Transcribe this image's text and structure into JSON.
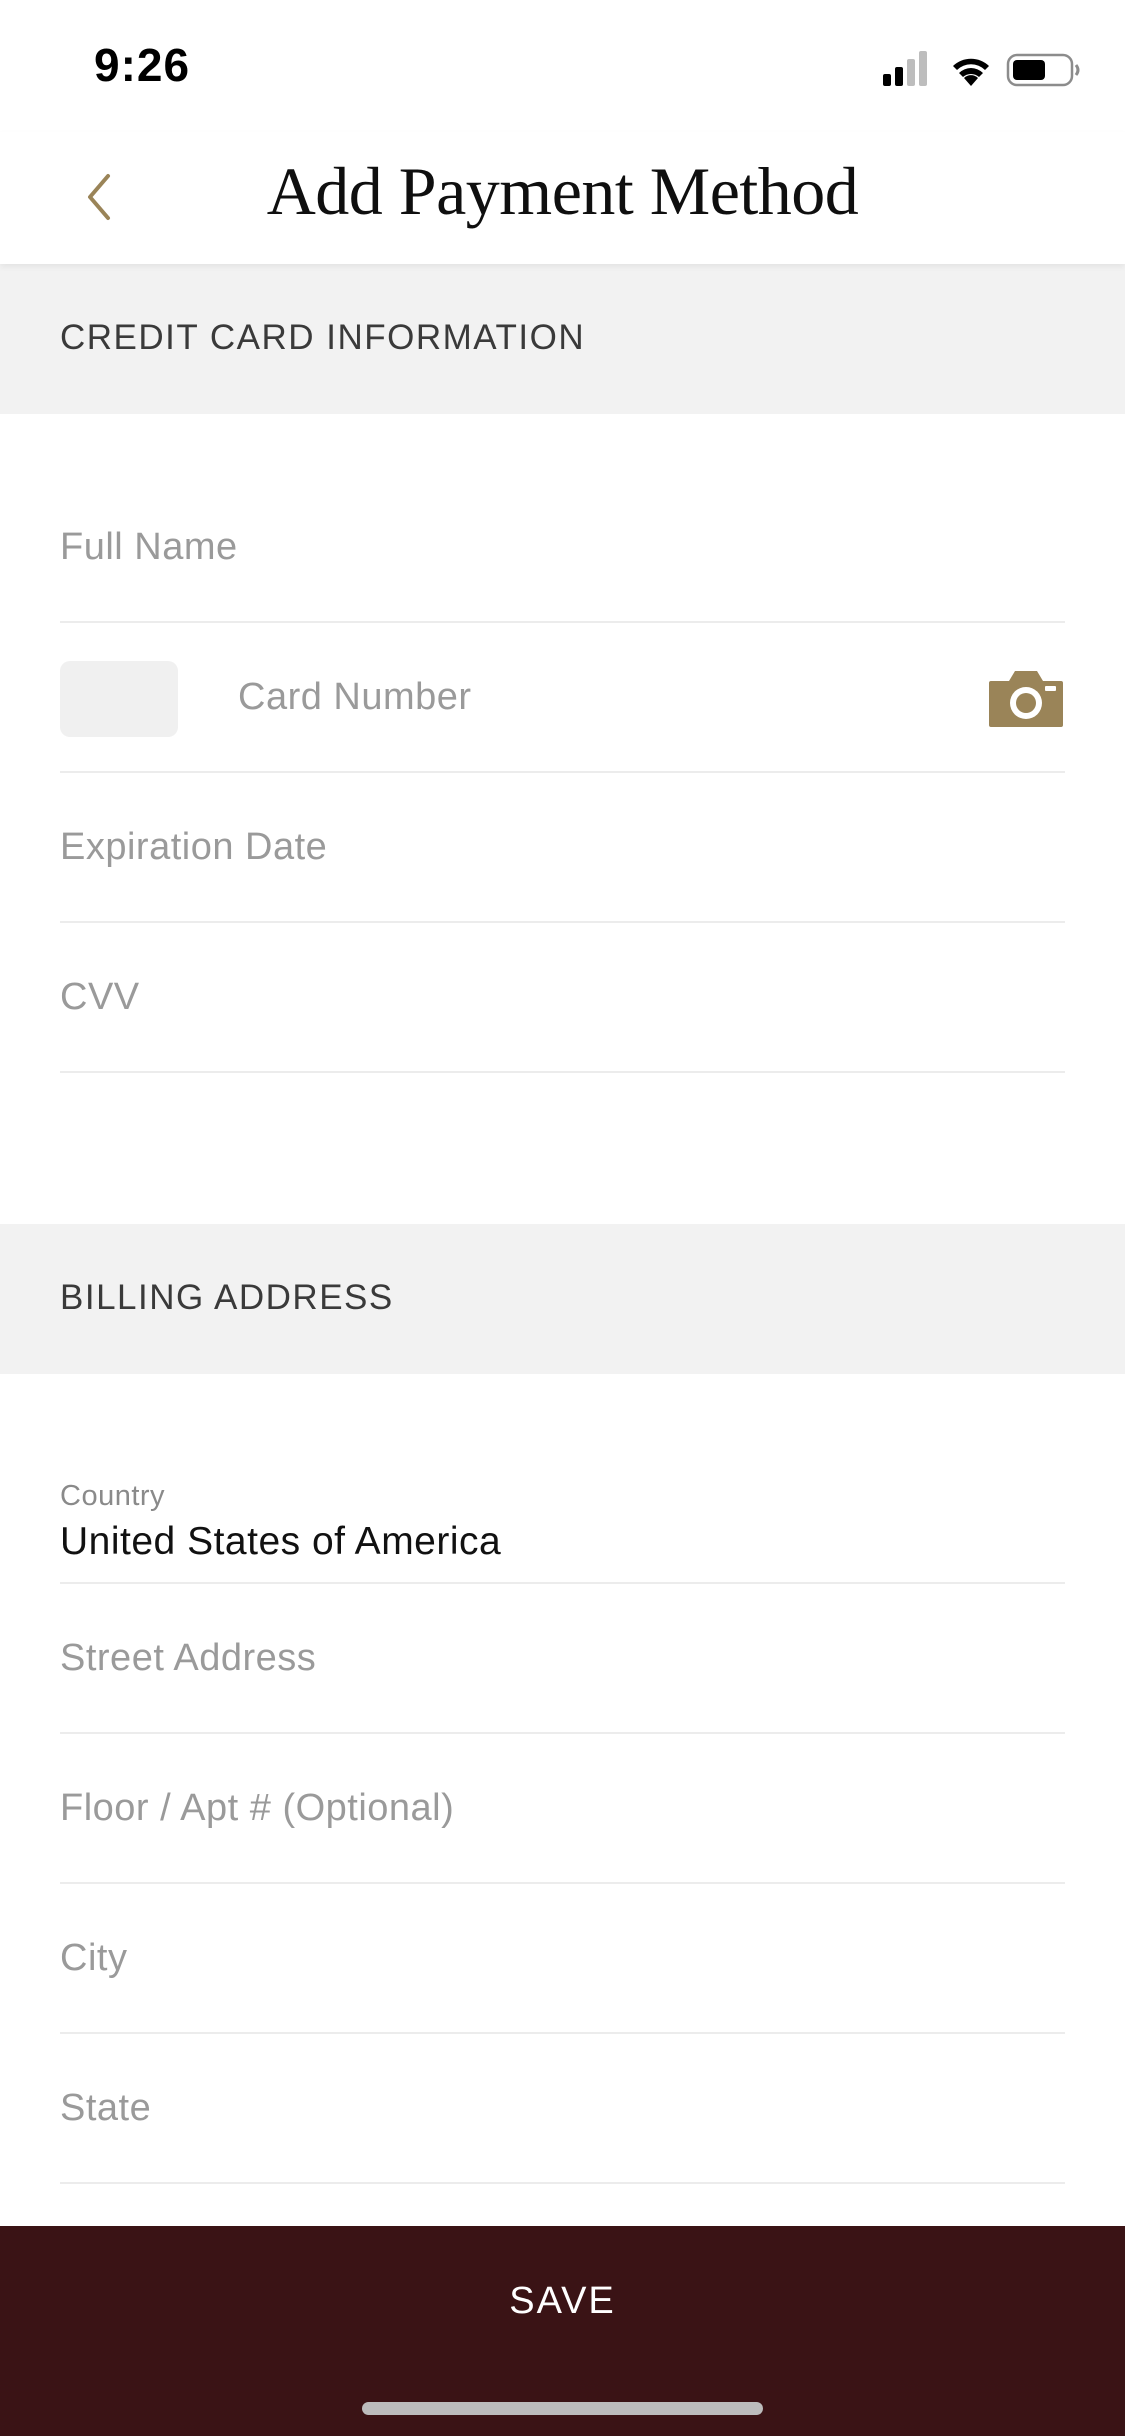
{
  "status_bar": {
    "time": "9:26"
  },
  "nav": {
    "title": "Add Payment Method",
    "back_icon": "chevron-left-icon"
  },
  "credit_card_section": {
    "header": "CREDIT CARD INFORMATION",
    "full_name": {
      "placeholder": "Full Name",
      "value": ""
    },
    "card_number": {
      "placeholder": "Card Number",
      "value": "",
      "scan_icon": "camera-icon"
    },
    "expiration_date": {
      "placeholder": "Expiration Date",
      "value": ""
    },
    "cvv": {
      "placeholder": "CVV",
      "value": ""
    }
  },
  "billing_section": {
    "header": "BILLING ADDRESS",
    "country": {
      "label": "Country",
      "value": "United States of America"
    },
    "street_address": {
      "placeholder": "Street Address",
      "value": ""
    },
    "floor_apt": {
      "placeholder": "Floor / Apt # (Optional)",
      "value": ""
    },
    "city": {
      "placeholder": "City",
      "value": ""
    },
    "state": {
      "placeholder": "State",
      "value": ""
    }
  },
  "footer": {
    "save_label": "SAVE"
  },
  "colors": {
    "accent": "#9a8458",
    "save_bar": "#3a1315",
    "section_bg": "#f2f2f2",
    "placeholder": "#9a9a9a"
  }
}
